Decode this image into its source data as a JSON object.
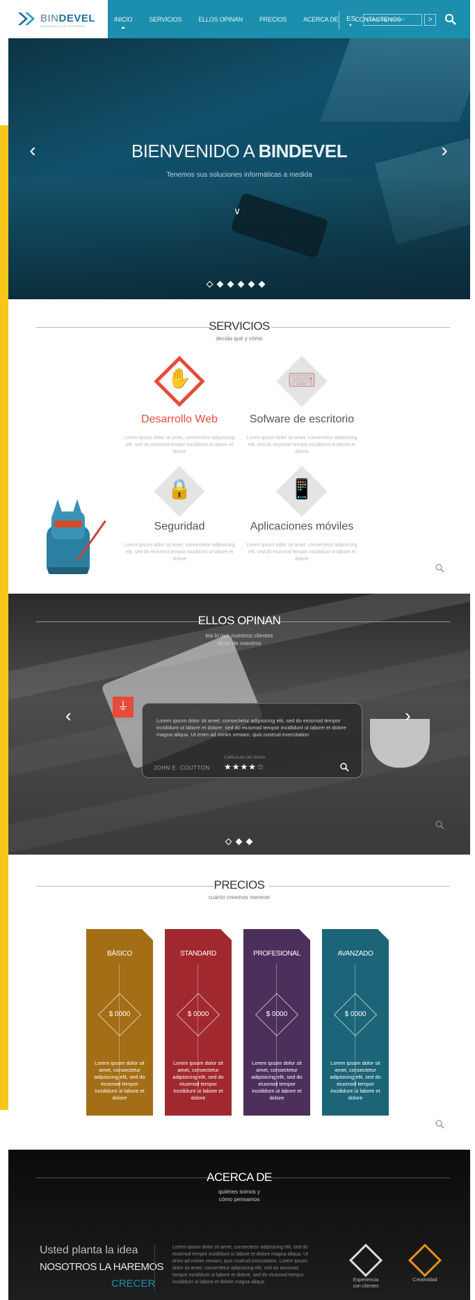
{
  "brand": {
    "logo_main": "BIN",
    "logo_bold": "DEVEL",
    "logo_sub": "DESARROLLO DE SOFTWARE"
  },
  "nav": {
    "items": [
      "INICIO",
      "SERVICIOS",
      "ELLOS OPINAN",
      "PRECIOS",
      "ACERCA DE",
      "CONTACTENOS"
    ],
    "active": "INICIO",
    "lang": "ES",
    "search_placeholder": "Qué deseas buscar?",
    "search_go": ">"
  },
  "hero": {
    "title_light": "BIENVENIDO A ",
    "title_bold": "BINDEVEL",
    "subtitle": "Tenemos sus soluciones informáticas a medida",
    "slides": 6,
    "active_slide": 1
  },
  "servicios": {
    "title": "SERVICIOS",
    "subtitle": "decida qué y cómo",
    "items": [
      {
        "name": "Desarrollo Web",
        "desc": "Lorem ipsum dolor sit amet, consectetur adipisicing elit, sed do eiusmod tempor incididunt ut labore et dolore",
        "highlight": true
      },
      {
        "name": "Sofware de escritorio",
        "desc": "Lorem ipsum dolor sit amet, consectetur adipisicing elit, sed do eiusmod tempor incididunt ut labore et dolore",
        "highlight": false
      },
      {
        "name": "Seguridad",
        "desc": "Lorem ipsum dolor sit amet, consectetur adipisicing elit, sed do eiusmod tempor incididunt ut labore et dolore",
        "highlight": false
      },
      {
        "name": "Aplicaciones móviles",
        "desc": "Lorem ipsum dolor sit amet, consectetur adipisicing elit, sed do eiusmod tempor incididunt ut labore et dolore",
        "highlight": false
      }
    ]
  },
  "opinan": {
    "title": "ELLOS OPINAN",
    "subtitle_1": "lea lo que nuestros clientes",
    "subtitle_2": "dicen de nosotros",
    "quote": "Lorem ipsum dolor sit amet, consectetur adipisicing elit, sed do eiusmod tempor incididunt ut labore et dolore. sed do eiusmod tempor incididunt ut labore et dolore magna aliqua. Ut enim ad minim veniam, quis nostrud exercitation",
    "author": "JOHN E. COUTTON",
    "rating_label": "Calificación del cliente",
    "rating": 4,
    "rating_max": 5,
    "slides": 3,
    "active_slide": 1
  },
  "precios": {
    "title": "PRECIOS",
    "subtitle": "cuánto creemos merecer",
    "plans": [
      {
        "name": "BÁSICO",
        "price": "$ 0000",
        "color": "#a46e16",
        "desc": "Lorem ipsum dolor sit amet, consectetur adipisicing elit, sed do eiusmod tempor incididunt ut labore et dolore"
      },
      {
        "name": "STANDARD",
        "price": "$ 0000",
        "color": "#a0282e",
        "desc": "Lorem ipsum dolor sit amet, consectetur adipisicing elit, sed do eiusmod tempor incididunt ut labore et dolore"
      },
      {
        "name": "PROFESIONAL",
        "price": "$ 0000",
        "color": "#4c2f5b",
        "desc": "Lorem ipsum dolor sit amet, consectetur adipisicing elit, sed do eiusmod tempor incididunt ut labore et dolore"
      },
      {
        "name": "AVANZADO",
        "price": "$ 0000",
        "color": "#1c6478",
        "desc": "Lorem ipsum dolor sit amet, consectetur adipisicing elit, sed do eiusmod tempor incididunt ut labore et dolore"
      }
    ]
  },
  "acerca": {
    "title": "ACERCA DE",
    "subtitle_1": "quiénes somos y",
    "subtitle_2": "cómo pensamos",
    "tag_1": "Usted planta la idea",
    "tag_2": "NOSOTROS LA HAREMOS",
    "tag_3": "CRECER",
    "text": "Lorem ipsum dolor sit amet, consectetur adipisicing elit, sed do eiusmod tempor incididunt ut labore et dolore magna aliqua. Ut enim ad minim veniam, quis nostrud exercitation. Lorem ipsum dolor sit amet, consectetur adipisicing elit, sed do eiusmod tempor incididunt ut labore et dolore, sed do eiusmod tempor incididunt ut labore et dolore magna aliqua.",
    "features": [
      {
        "label_1": "Experiencia",
        "label_2": "con clientes",
        "color": "#8a6bd0"
      },
      {
        "label_1": "Creatividad",
        "label_2": "",
        "color": "#e8901a"
      }
    ]
  },
  "colors": {
    "nav": "#1b8fad",
    "accent_red": "#e84a3a",
    "side_strip": "#f6c71a"
  }
}
